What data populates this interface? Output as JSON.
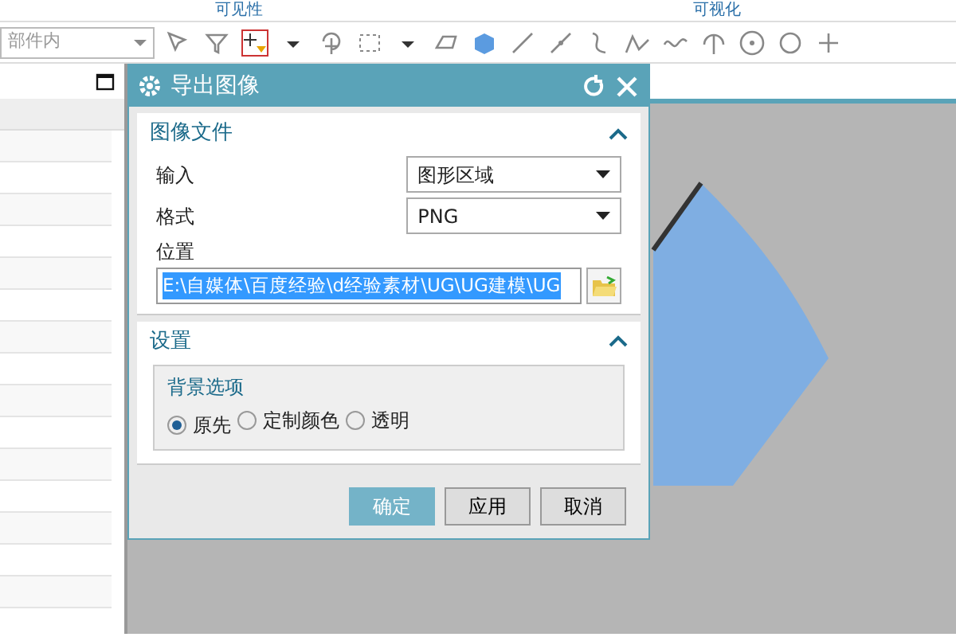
{
  "ribbon_groups": [
    "可见性",
    "可视化"
  ],
  "toolbar": {
    "scope_field": {
      "placeholder": "部件内"
    }
  },
  "dialog": {
    "title": "导出图像",
    "sections": [
      {
        "title": "图像文件",
        "expanded": true,
        "fields": [
          {
            "kind": "select",
            "label": "输入",
            "value": "图形区域"
          },
          {
            "kind": "select",
            "label": "格式",
            "value": "PNG"
          },
          {
            "kind": "path",
            "label": "位置",
            "value": "E:\\自媒体\\百度经验\\d经验素材\\UG\\UG建模\\UG",
            "highlighted": true
          }
        ]
      },
      {
        "title": "设置",
        "expanded": true,
        "group": {
          "title": "背景选项",
          "options": [
            {
              "label": "原先",
              "selected": true
            },
            {
              "label": "定制颜色",
              "selected": false
            },
            {
              "label": "透明",
              "selected": false
            }
          ]
        }
      }
    ],
    "buttons": [
      {
        "label": "确定",
        "kind": "primary"
      },
      {
        "label": "应用",
        "kind": "default"
      },
      {
        "label": "取消",
        "kind": "default"
      }
    ]
  }
}
